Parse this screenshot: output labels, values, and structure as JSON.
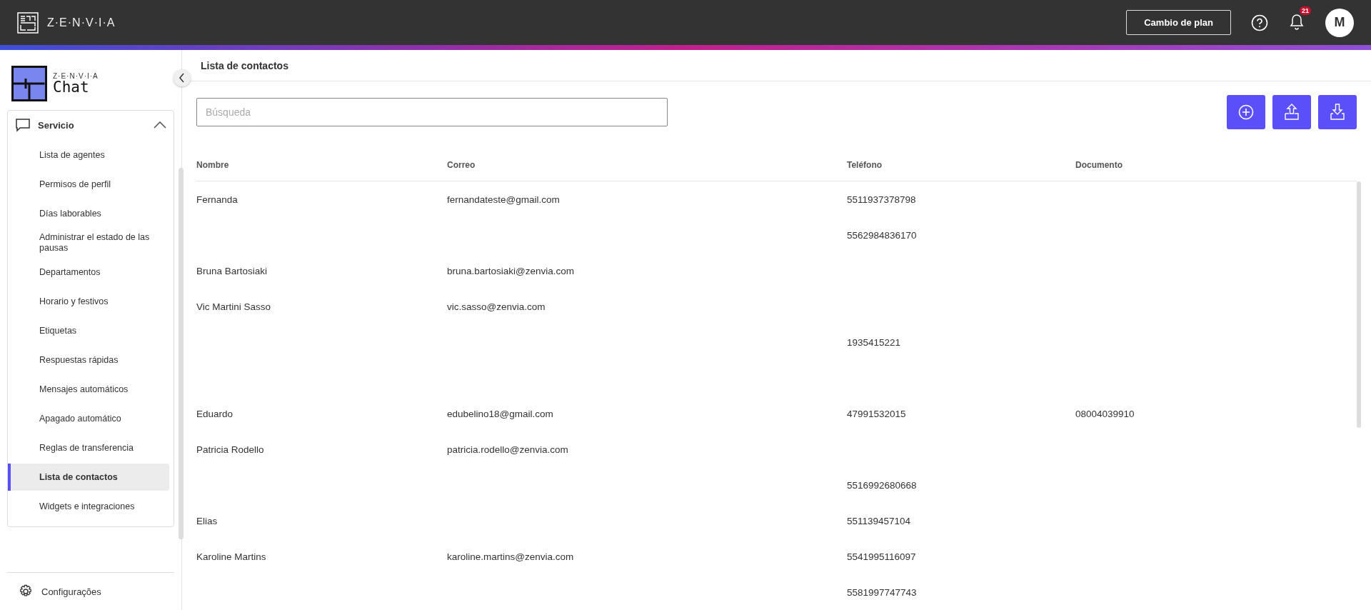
{
  "topbar": {
    "brand": "Z·E·N·V·I·A",
    "plan_button": "Cambio de plan",
    "notifications_count": "21",
    "avatar_initial": "M"
  },
  "sidebar": {
    "logo_brand": "Z·E·N·V·I·A",
    "logo_product": "Chat",
    "group": {
      "label": "Servicio",
      "expanded": true,
      "items": [
        {
          "label": "Lista de agentes",
          "selected": false
        },
        {
          "label": "Permisos de perfil",
          "selected": false
        },
        {
          "label": "Días laborables",
          "selected": false
        },
        {
          "label": "Administrar el estado de las pausas",
          "selected": false
        },
        {
          "label": "Departamentos",
          "selected": false
        },
        {
          "label": "Horario y festivos",
          "selected": false
        },
        {
          "label": "Etiquetas",
          "selected": false
        },
        {
          "label": "Respuestas rápidas",
          "selected": false
        },
        {
          "label": "Mensajes automáticos",
          "selected": false
        },
        {
          "label": "Apagado automático",
          "selected": false
        },
        {
          "label": "Reglas de transferencia",
          "selected": false
        },
        {
          "label": "Lista de contactos",
          "selected": true
        },
        {
          "label": "Widgets e integraciones",
          "selected": false
        }
      ]
    },
    "footer_item": "Configurações"
  },
  "page": {
    "title": "Lista de contactos",
    "search": {
      "placeholder": "Búsqueda"
    },
    "table": {
      "columns": [
        "Nombre",
        "Correo",
        "Teléfono",
        "Documento"
      ],
      "rows": [
        {
          "name": "Fernanda",
          "email": "fernandateste@gmail.com",
          "phone": "5511937378798"
        },
        {
          "phone": "5562984836170"
        },
        {
          "name": "Bruna Bartosiaki",
          "email": "bruna.bartosiaki@zenvia.com"
        },
        {
          "name": "Vic Martini Sasso",
          "email": "vic.sasso@zenvia.com"
        },
        {
          "phone": "1935415221"
        },
        {},
        {
          "name": "Eduardo",
          "email": "edubelino18@gmail.com",
          "phone": "47991532015",
          "document": "08004039910"
        },
        {
          "name": "Patricia Rodello",
          "email": "patricia.rodello@zenvia.com"
        },
        {
          "phone": "5516992680668"
        },
        {
          "name": "Elias",
          "phone": "551139457104"
        },
        {
          "name": "Karoline Martins",
          "email": "karoline.martins@zenvia.com",
          "phone": "5541995116097"
        },
        {
          "phone": "5581997747743"
        }
      ]
    }
  }
}
